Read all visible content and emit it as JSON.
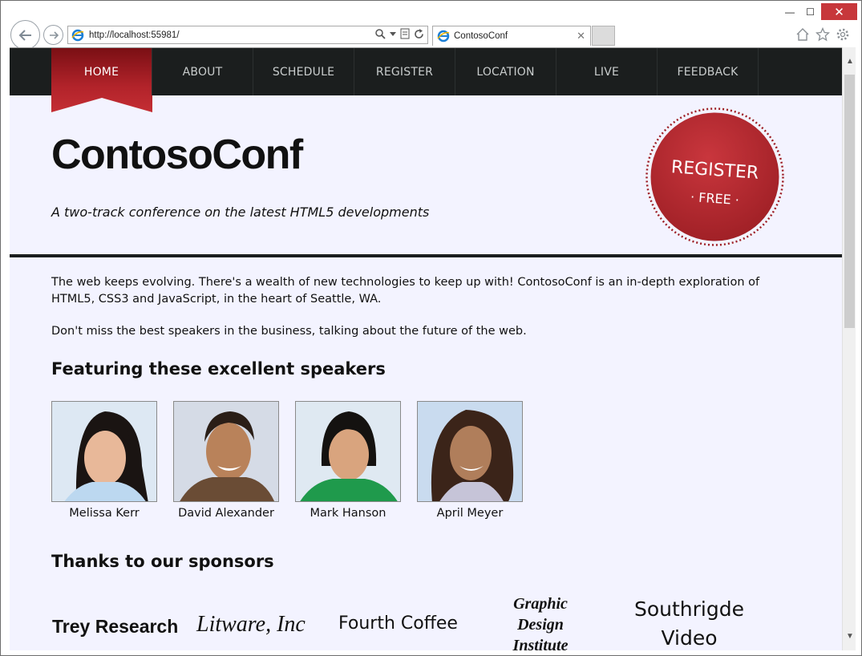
{
  "browser": {
    "address": "http://localhost:55981/",
    "tab_title": "ContosoConf",
    "window_controls": {
      "minimize": "—",
      "maximize": "☐",
      "close": "✕"
    }
  },
  "nav": {
    "items": [
      {
        "label": "HOME",
        "active": true
      },
      {
        "label": "ABOUT"
      },
      {
        "label": "SCHEDULE"
      },
      {
        "label": "REGISTER"
      },
      {
        "label": "LOCATION"
      },
      {
        "label": "LIVE"
      },
      {
        "label": "FEEDBACK"
      }
    ]
  },
  "header": {
    "title": "ContosoConf",
    "tagline": "A two-track conference on the latest HTML5 developments",
    "badge": {
      "line1": "REGISTER",
      "line2": "· FREE ·"
    }
  },
  "intro": {
    "p1": "The web keeps evolving. There's a wealth of new technologies to keep up with! ContosoConf is an in-depth exploration of HTML5, CSS3 and JavaScript, in the heart of Seattle, WA.",
    "p2": "Don't miss the best speakers in the business, talking about the future of the web."
  },
  "speakers": {
    "heading": "Featuring these excellent speakers",
    "list": [
      {
        "name": "Melissa Kerr"
      },
      {
        "name": "David Alexander"
      },
      {
        "name": "Mark Hanson"
      },
      {
        "name": "April Meyer"
      }
    ]
  },
  "sponsors": {
    "heading": "Thanks to our sponsors",
    "list": [
      {
        "name": "Trey Research"
      },
      {
        "name": "Litware, Inc"
      },
      {
        "name": "Fourth Coffee"
      },
      {
        "name": "Graphic Design Institute"
      },
      {
        "name": "Southrigde Video"
      }
    ]
  },
  "colors": {
    "nav_bg": "#1b1e1e",
    "accent": "#b2232a",
    "page_bg": "#f3f3ff"
  }
}
